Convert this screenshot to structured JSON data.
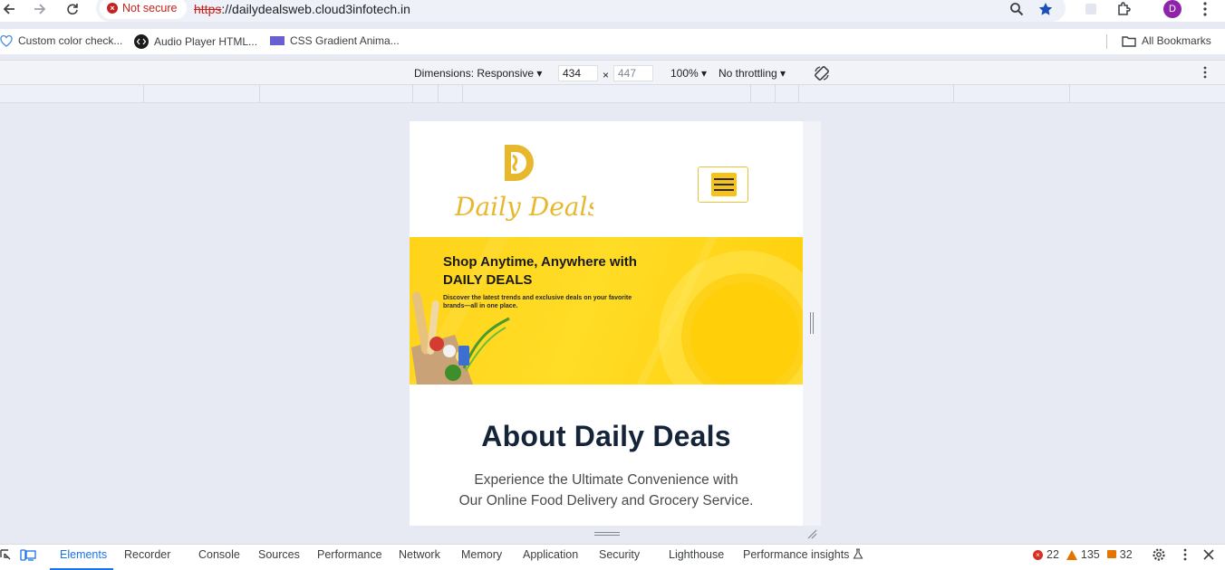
{
  "browser": {
    "security_label": "Not secure",
    "url_scheme": "https",
    "url_rest": "://dailydealsweb.cloud3infotech.in",
    "profile_initial": "D"
  },
  "bookmarks": [
    {
      "label": "Custom color check...",
      "icon": "heart-icon"
    },
    {
      "label": "Audio Player HTML...",
      "icon": "code-icon"
    },
    {
      "label": "CSS Gradient Anima...",
      "icon": "folder-color-icon"
    }
  ],
  "bookmarks_all": "All Bookmarks",
  "device_toolbar": {
    "dimensions": "Dimensions: Responsive",
    "width": "434",
    "times": "×",
    "height": "447",
    "zoom": "100%",
    "throttling": "No throttling"
  },
  "site": {
    "logo_text": "Daily Deals",
    "banner_title": "Shop Anytime, Anywhere with DAILY DEALS",
    "banner_sub": "Discover the latest trends and exclusive deals on your favorite brands—all in one place.",
    "about_title": "About Daily Deals",
    "about_sub_1": "Experience the Ultimate Convenience with",
    "about_sub_2": "Our Online Food Delivery and Grocery Service."
  },
  "devtools": {
    "tabs": [
      "Elements",
      "Recorder",
      "Console",
      "Sources",
      "Performance",
      "Network",
      "Memory",
      "Application",
      "Security",
      "Lighthouse",
      "Performance insights"
    ],
    "errors": "22",
    "warnings": "135",
    "issues": "32"
  },
  "colors": {
    "brand_yellow": "#f6c31a",
    "error_red": "#c5221f",
    "link_blue": "#1a73e8"
  }
}
